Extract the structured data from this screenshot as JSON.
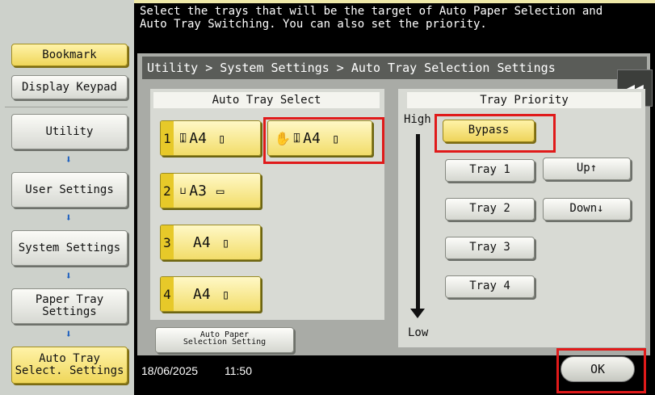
{
  "header": {
    "instruction": "Select the trays that will be the target of Auto Paper Selection and\nAuto Tray Switching. You can also set the priority."
  },
  "sidebar": {
    "bookmark": "Bookmark",
    "display_keypad": "Display Keypad",
    "nav": [
      {
        "label": "Utility"
      },
      {
        "label": "User Settings"
      },
      {
        "label": "System Settings"
      },
      {
        "label": "Paper Tray\nSettings"
      },
      {
        "label": "Auto Tray\nSelect. Settings"
      }
    ]
  },
  "breadcrumb": "Utility > System Settings > Auto Tray Selection Settings",
  "auto_tray_select": {
    "title": "Auto Tray Select",
    "trays": [
      {
        "num": "1",
        "size": "A4"
      },
      {
        "num": "",
        "size": "A4"
      },
      {
        "num": "2",
        "size": "A3"
      },
      {
        "num": "3",
        "size": "A4"
      },
      {
        "num": "4",
        "size": "A4"
      }
    ],
    "auto_paper_button": "Auto Paper\nSelection Setting"
  },
  "tray_priority": {
    "title": "Tray Priority",
    "high": "High",
    "low": "Low",
    "items": [
      "Bypass",
      "Tray 1",
      "Tray 2",
      "Tray 3",
      "Tray 4"
    ],
    "up": "Up↑",
    "down": "Down↓"
  },
  "footer": {
    "date": "18/06/2025",
    "time": "11:50"
  },
  "ok": "OK",
  "colors": {
    "accent_yellow": "#f2dd6a",
    "highlight_red": "#e01a1a"
  }
}
